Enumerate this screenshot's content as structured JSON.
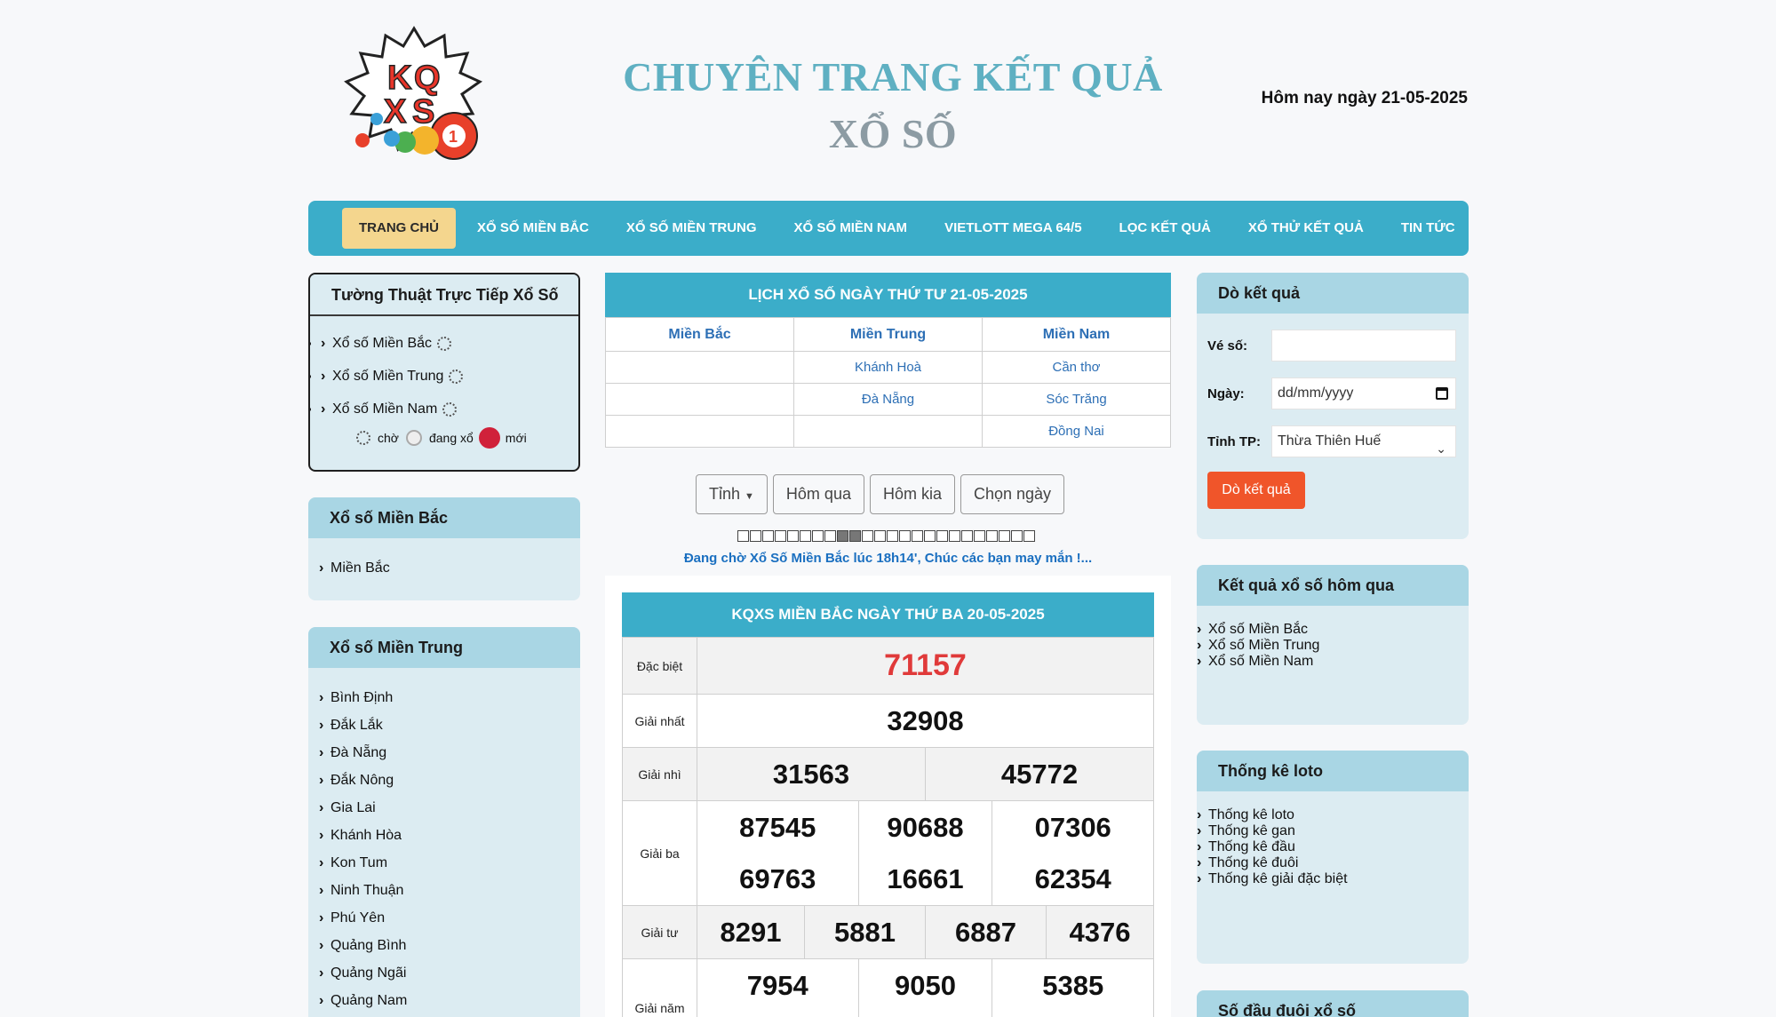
{
  "header": {
    "logo_alt": "KQXS logo",
    "title_line1": "CHUYÊN TRANG KẾT QUẢ",
    "title_line2": "XỔ SỐ",
    "today": "Hôm nay ngày 21-05-2025"
  },
  "nav": [
    {
      "label": "TRANG CHỦ",
      "active": true
    },
    {
      "label": "XỔ SỐ MIỀN BẮC"
    },
    {
      "label": "XỔ SỐ MIỀN TRUNG"
    },
    {
      "label": "XỔ SỐ MIỀN NAM"
    },
    {
      "label": "VIETLOTT MEGA 64/5"
    },
    {
      "label": "LỌC KẾT QUẢ"
    },
    {
      "label": "XỔ THỬ KẾT QUẢ"
    },
    {
      "label": "TIN TỨC"
    }
  ],
  "live": {
    "title": "Tường Thuật Trực Tiếp Xổ Số",
    "items": [
      "Xổ số Miền Bắc",
      "Xổ số Miền Trung",
      "Xổ số Miền Nam"
    ],
    "legend": {
      "wait": "chờ",
      "rolling": "đang xổ",
      "new": "mới"
    }
  },
  "north_box": {
    "title": "Xổ số Miền Bắc",
    "items": [
      "Miền Bắc"
    ]
  },
  "central_box": {
    "title": "Xổ số Miền Trung",
    "items": [
      "Bình Định",
      "Đắk Lắk",
      "Đà Nẵng",
      "Đắk Nông",
      "Gia Lai",
      "Khánh Hòa",
      "Kon Tum",
      "Ninh Thuận",
      "Phú Yên",
      "Quảng Bình",
      "Quảng Ngãi",
      "Quảng Nam"
    ]
  },
  "schedule": {
    "title": "LỊCH XỔ SỐ NGÀY THỨ TƯ 21-05-2025",
    "headers": [
      "Miền Bắc",
      "Miền Trung",
      "Miền Nam"
    ],
    "rows": [
      [
        "",
        "Khánh Hoà",
        "Cần thơ"
      ],
      [
        "",
        "Đà Nẵng",
        "Sóc Trăng"
      ],
      [
        "",
        "",
        "Đồng Nai"
      ]
    ]
  },
  "filters": {
    "province": "Tỉnh",
    "yesterday": "Hôm qua",
    "day_before": "Hôm kia",
    "choose_date": "Chọn ngày"
  },
  "progress": {
    "total": 24,
    "filled": [
      8,
      9
    ]
  },
  "waiting_text": "Đang chờ Xổ Số Miền Bắc lúc 18h14', Chúc các bạn may mắn !...",
  "results": {
    "title": "KQXS MIỀN BẮC NGÀY THỨ BA 20-05-2025",
    "special": {
      "label": "Đặc biệt",
      "value": "71157"
    },
    "first": {
      "label": "Giải nhất",
      "value": "32908"
    },
    "second": {
      "label": "Giải nhì",
      "values": [
        "31563",
        "45772"
      ]
    },
    "third": {
      "label": "Giải ba",
      "values": [
        "87545",
        "90688",
        "07306",
        "69763",
        "16661",
        "62354"
      ]
    },
    "fourth": {
      "label": "Giải tư",
      "values": [
        "8291",
        "5881",
        "6887",
        "4376"
      ]
    },
    "fifth": {
      "label": "Giải năm",
      "values": [
        "7954",
        "9050",
        "5385"
      ]
    }
  },
  "check": {
    "title": "Dò kết quả",
    "ticket_label": "Vé số:",
    "ticket_value": "",
    "date_label": "Ngày:",
    "date_placeholder": "dd/mm/yyyy",
    "province_label": "Tỉnh TP:",
    "province_value": "Thừa Thiên Huế",
    "button": "Dò kết quả"
  },
  "yesterday_box": {
    "title": "Kết quả xổ số hôm qua",
    "items": [
      "Xổ số Miền Bắc",
      "Xổ số Miền Trung",
      "Xổ số Miền Nam"
    ]
  },
  "stats_box": {
    "title": "Thống kê loto",
    "items": [
      "Thống kê loto",
      "Thống kê gan",
      "Thống kê đầu",
      "Thống kê đuôi",
      "Thống kê giải đặc biệt"
    ]
  },
  "headtail_box": {
    "title": "Số đầu đuôi xổ số"
  }
}
